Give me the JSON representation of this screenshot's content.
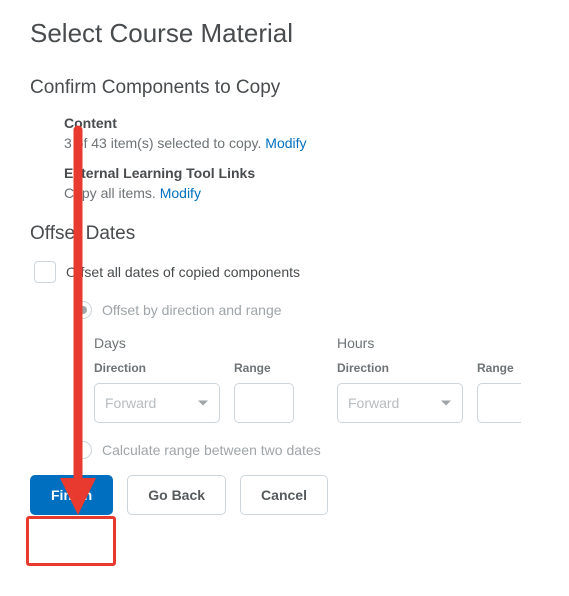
{
  "page_title": "Select Course Material",
  "components_section_title": "Confirm Components to Copy",
  "components": [
    {
      "name": "Content",
      "desc_prefix": "3 of 43 item(s) selected to copy. ",
      "link": "Modify"
    },
    {
      "name": "External Learning Tool Links",
      "desc_prefix": "Copy all items. ",
      "link": "Modify"
    }
  ],
  "offset_section_title": "Offset Dates",
  "offset_checkbox_label": "Offset all dates of copied components",
  "offset_radio_direction_range": "Offset by direction and range",
  "offset_radio_calculate": "Calculate range between two dates",
  "units": {
    "days": "Days",
    "hours": "Hours"
  },
  "field_labels": {
    "direction": "Direction",
    "range": "Range"
  },
  "direction_option": "Forward",
  "buttons": {
    "finish": "Finish",
    "go_back": "Go Back",
    "cancel": "Cancel"
  },
  "annotation": {
    "arrow_color": "#e83a2e"
  }
}
